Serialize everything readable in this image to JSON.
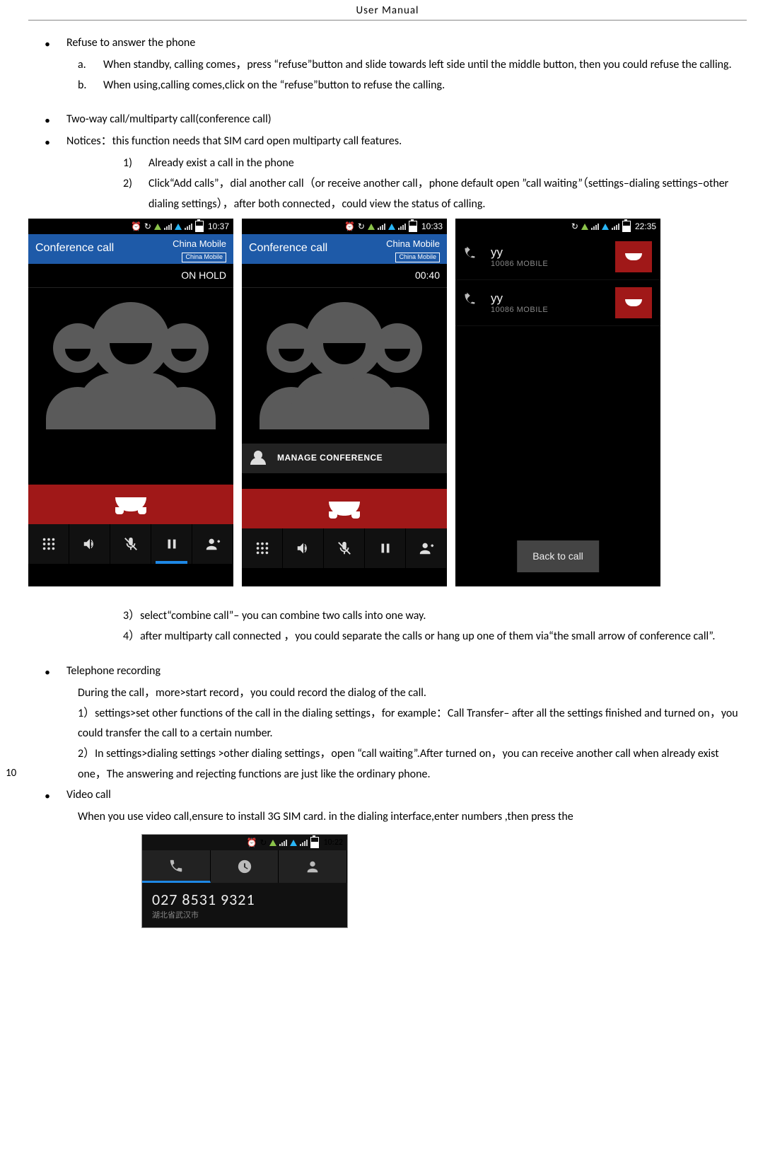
{
  "header": {
    "title": "User  Manual"
  },
  "page_number": "10",
  "sections": {
    "refuse": {
      "title": "Refuse to answer the phone",
      "a_label": "a.",
      "a_text": "When standby, calling comes，press “refuse”button and slide towards left side until the middle button, then you could refuse the calling.",
      "b_label": "b.",
      "b_text": "When using,calling comes,click on the “refuse”button to refuse the calling."
    },
    "twoway": {
      "title": "Two-way call/multiparty call(conference call)",
      "notice_title": "Notices：this   function needs that SIM card open multiparty call features.",
      "n1_label": "1)",
      "n1_text": "Already exist a call in the phone",
      "n2_label": "2)",
      "n2_text": "Click“Add calls”，dial another call（or receive another call，phone default open ”call waiting”（settings–dialing settings–other dialing settings），after both connected，could view the status of calling.",
      "n3_text": "3）select“combine call”– you can combine two calls into one way.",
      "n4_text": "4）after multiparty call connected ，you could separate the calls or hang up one of them via“the small arrow of conference call”."
    },
    "recording": {
      "title": "Telephone recording",
      "p1": "During the call，more>start record，you could record the dialog of the call.",
      "p2": "  1）settings>set other functions of the call in the dialing settings，for example：Call Transfer– after all the settings finished and turned on，you could transfer the call to a certain number.",
      "p3": "  2）In settings>dialing settings >other dialing settings，open “call waiting”.After turned on，you can receive another call when already exist one，The answering and rejecting functions are just like the ordinary phone."
    },
    "video": {
      "title": "Video call",
      "p1": "When you use video call,ensure to install 3G SIM card. in the dialing interface,enter numbers ,then press the"
    }
  },
  "phone1": {
    "time": "10:37",
    "conf_label": "Conference call",
    "carrier": "China Mobile",
    "chip": "China Mobile",
    "status": "ON HOLD"
  },
  "phone2": {
    "time": "10:33",
    "conf_label": "Conference call",
    "carrier": "China Mobile",
    "chip": "China Mobile",
    "duration": "00:40",
    "manage": "MANAGE CONFERENCE"
  },
  "phone3": {
    "time": "22:35",
    "calls": [
      {
        "name": "yy",
        "sub": "10086  MOBILE"
      },
      {
        "name": "yy",
        "sub": "10086  MOBILE"
      }
    ],
    "back": "Back to call"
  },
  "dialer": {
    "time": "10:22",
    "number": "027 8531 9321",
    "location": "湖北省武汉市"
  }
}
